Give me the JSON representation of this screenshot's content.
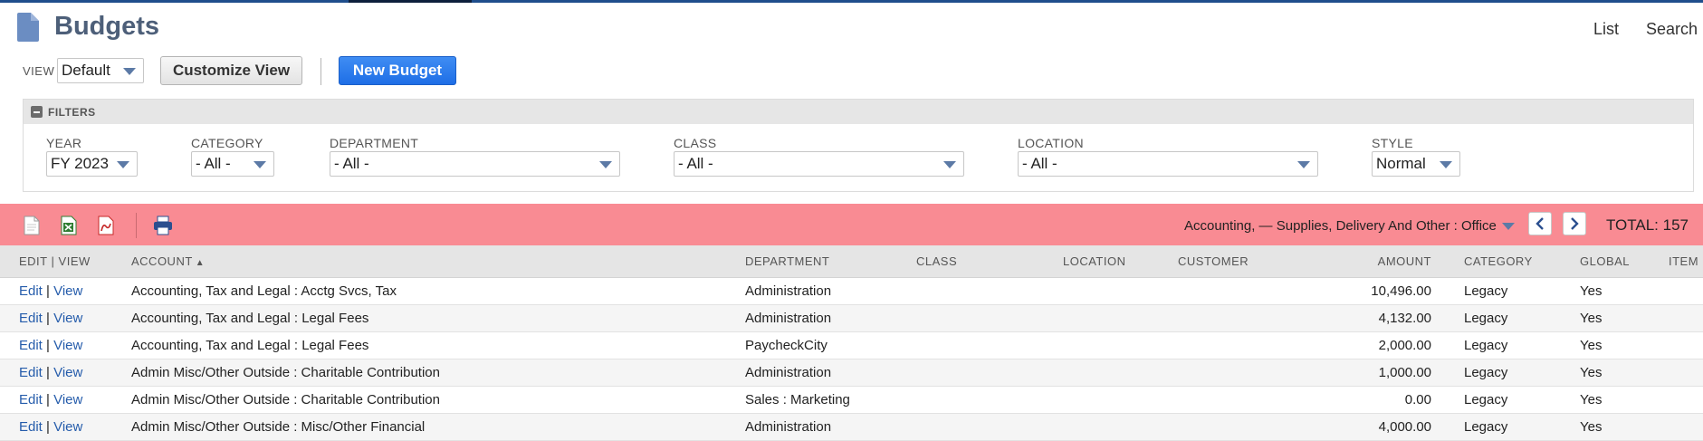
{
  "page": {
    "title": "Budgets",
    "top_links": {
      "list": "List",
      "search": "Search"
    }
  },
  "view_bar": {
    "view_label": "VIEW",
    "view_value": "Default",
    "customize_label": "Customize View",
    "new_label": "New Budget"
  },
  "filters": {
    "title": "FILTERS",
    "year": {
      "label": "YEAR",
      "value": "FY 2023"
    },
    "category": {
      "label": "CATEGORY",
      "value": "- All -"
    },
    "department": {
      "label": "DEPARTMENT",
      "value": "- All -"
    },
    "class": {
      "label": "CLASS",
      "value": "- All -"
    },
    "location": {
      "label": "LOCATION",
      "value": "- All -"
    },
    "style": {
      "label": "STYLE",
      "value": "Normal"
    }
  },
  "toolbar": {
    "icons": [
      "new-document-icon",
      "export-excel-icon",
      "export-pdf-icon",
      "print-icon"
    ],
    "sort_value": "Accounting, — Supplies, Delivery And Other : Office",
    "total_label": "TOTAL: 157"
  },
  "table": {
    "headers": {
      "edit": "EDIT",
      "view": "VIEW",
      "account": "ACCOUNT",
      "department": "DEPARTMENT",
      "class": "CLASS",
      "location": "LOCATION",
      "customer": "CUSTOMER",
      "amount": "AMOUNT",
      "category": "CATEGORY",
      "global": "GLOBAL",
      "item": "ITEM"
    },
    "link_edit": "Edit",
    "link_view": "View",
    "separator": "|",
    "rows": [
      {
        "account": "Accounting, Tax and Legal : Acctg Svcs, Tax",
        "department": "Administration",
        "class": "",
        "location": "",
        "customer": "",
        "amount": "10,496.00",
        "category": "Legacy",
        "global": "Yes",
        "item": ""
      },
      {
        "account": "Accounting, Tax and Legal : Legal Fees",
        "department": "Administration",
        "class": "",
        "location": "",
        "customer": "",
        "amount": "4,132.00",
        "category": "Legacy",
        "global": "Yes",
        "item": ""
      },
      {
        "account": "Accounting, Tax and Legal : Legal Fees",
        "department": "PaycheckCity",
        "class": "",
        "location": "",
        "customer": "",
        "amount": "2,000.00",
        "category": "Legacy",
        "global": "Yes",
        "item": ""
      },
      {
        "account": "Admin Misc/Other Outside : Charitable Contribution",
        "department": "Administration",
        "class": "",
        "location": "",
        "customer": "",
        "amount": "1,000.00",
        "category": "Legacy",
        "global": "Yes",
        "item": ""
      },
      {
        "account": "Admin Misc/Other Outside : Charitable Contribution",
        "department": "Sales : Marketing",
        "class": "",
        "location": "",
        "customer": "",
        "amount": "0.00",
        "category": "Legacy",
        "global": "Yes",
        "item": ""
      },
      {
        "account": "Admin Misc/Other Outside : Misc/Other Financial",
        "department": "Administration",
        "class": "",
        "location": "",
        "customer": "",
        "amount": "4,000.00",
        "category": "Legacy",
        "global": "Yes",
        "item": ""
      }
    ]
  }
}
